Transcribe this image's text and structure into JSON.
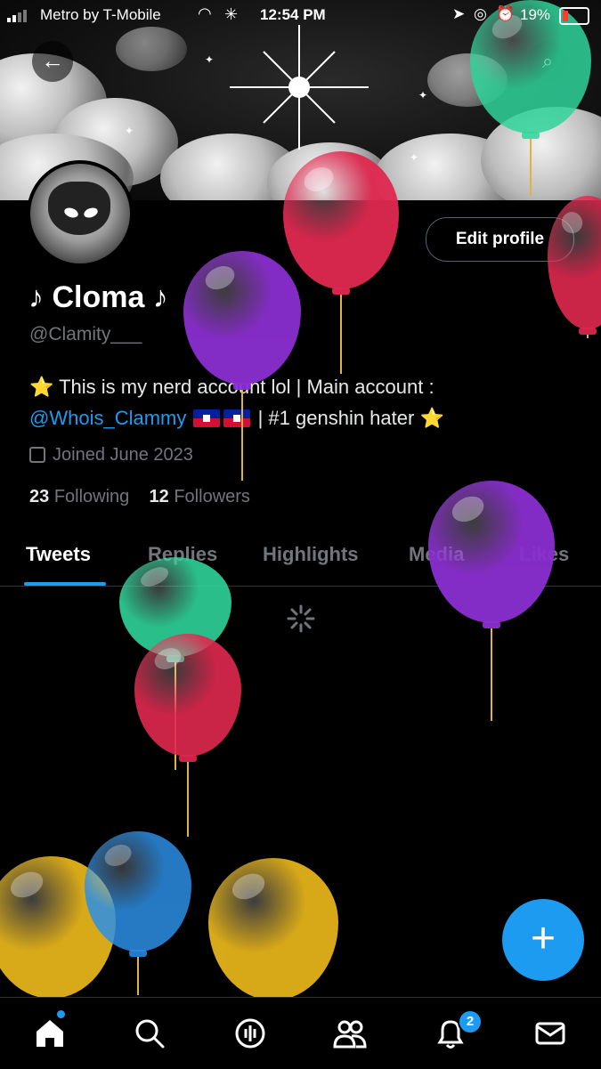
{
  "status_bar": {
    "carrier": "Metro by T-Mobile",
    "time": "12:54 PM",
    "battery": "19%"
  },
  "profile": {
    "display_name": "♪ Cloma ♪",
    "handle": "@Clamity___",
    "bio_line1": "⭐ This is my nerd account lol | Main account :",
    "bio_mention": "@Whois_Clammy",
    "bio_rest": " | #1 genshin hater ⭐",
    "joined": "Joined June 2023",
    "following_count": "23",
    "following_label": "Following",
    "followers_count": "12",
    "followers_label": "Followers",
    "edit_button": "Edit profile"
  },
  "tabs": [
    {
      "label": "Tweets"
    },
    {
      "label": "Replies"
    },
    {
      "label": "Highlights"
    },
    {
      "label": "Media"
    },
    {
      "label": "Likes"
    }
  ],
  "active_tab": "Tweets",
  "icons": {
    "back": "arrow-left-icon",
    "search": "search-icon",
    "compose": "plus-icon",
    "nav": [
      "home-icon",
      "search-icon",
      "spaces-icon",
      "communities-icon",
      "bell-icon",
      "mail-icon"
    ]
  },
  "notifications_badge": "2",
  "colors": {
    "accent": "#1d9bf0",
    "background": "#000000",
    "muted_text": "#71767b",
    "balloon_green": "#2fd39a",
    "balloon_red": "#e0284f",
    "balloon_purple": "#8b2fd0",
    "balloon_blue": "#2c8fe6",
    "balloon_yellow": "#e3b21a"
  }
}
